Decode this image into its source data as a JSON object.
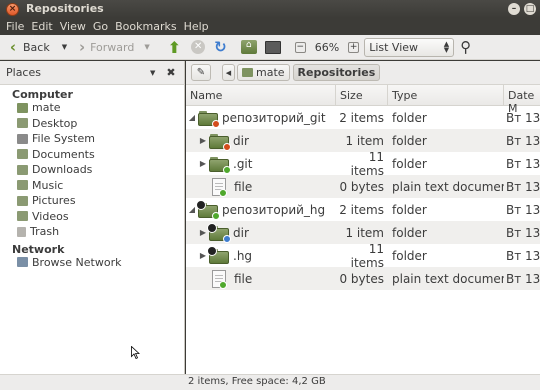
{
  "window": {
    "title": "Repositories"
  },
  "menu": [
    "File",
    "Edit",
    "View",
    "Go",
    "Bookmarks",
    "Help"
  ],
  "toolbar": {
    "back": "Back",
    "forward": "Forward",
    "zoom": "66%",
    "view_mode": "List View"
  },
  "sidebar_header": "Places",
  "pathbar": {
    "parent": "mate",
    "current": "Repositories"
  },
  "sidebar": {
    "computer_label": "Computer",
    "items": [
      "mate",
      "Desktop",
      "File System",
      "Documents",
      "Downloads",
      "Music",
      "Pictures",
      "Videos",
      "Trash"
    ],
    "network_label": "Network",
    "network_items": [
      "Browse Network"
    ]
  },
  "columns": {
    "name": "Name",
    "size": "Size",
    "type": "Type",
    "date": "Date M"
  },
  "rows": [
    {
      "name": "репозиторий_git",
      "size": "2 items",
      "type": "folder",
      "date": "Вт 13"
    },
    {
      "name": "dir",
      "size": "1 item",
      "type": "folder",
      "date": "Вт 13"
    },
    {
      "name": ".git",
      "size": "11 items",
      "type": "folder",
      "date": "Вт 13"
    },
    {
      "name": "file",
      "size": "0 bytes",
      "type": "plain text document",
      "date": "Вт 13"
    },
    {
      "name": "репозиторий_hg",
      "size": "2 items",
      "type": "folder",
      "date": "Вт 13"
    },
    {
      "name": "dir",
      "size": "1 item",
      "type": "folder",
      "date": "Вт 13"
    },
    {
      "name": ".hg",
      "size": "11 items",
      "type": "folder",
      "date": "Вт 13"
    },
    {
      "name": "file",
      "size": "0 bytes",
      "type": "plain text document",
      "date": "Вт 13"
    }
  ],
  "status": "2 items, Free space: 4,2 GB",
  "colors": {
    "folder": "#7e9360",
    "emblem_red": "#d44c1c",
    "emblem_green": "#4fa82c",
    "emblem_blue": "#3f7dcf"
  }
}
